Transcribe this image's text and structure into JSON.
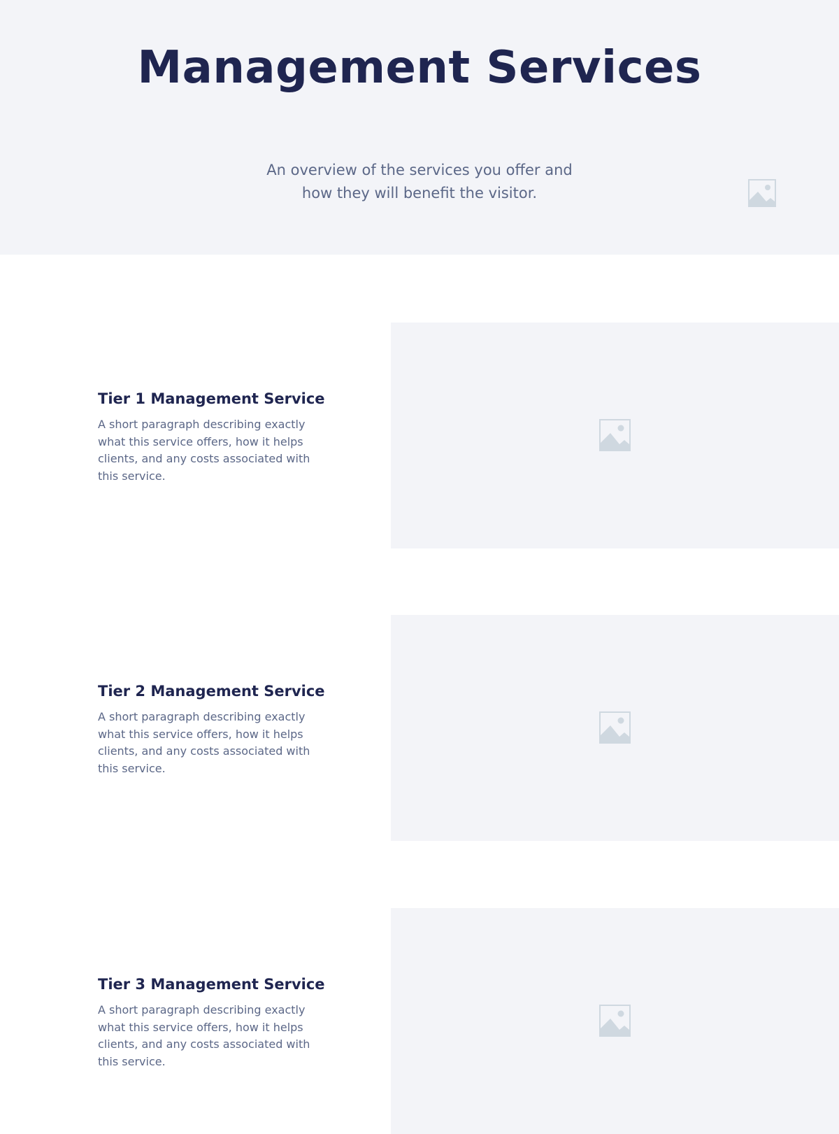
{
  "hero": {
    "title": "Management Services",
    "subtitle": "An overview of the services you offer and how they will benefit the visitor.",
    "icon": "image-placeholder-icon"
  },
  "services": [
    {
      "title": "Tier 1 Management Service",
      "description": "A short paragraph describing exactly what this service offers, how it helps clients, and any costs associated with this service.",
      "image_icon": "image-placeholder-icon"
    },
    {
      "title": "Tier 2 Management Service",
      "description": "A short paragraph describing exactly what this service offers, how it helps clients, and any costs associated with this service.",
      "image_icon": "image-placeholder-icon"
    },
    {
      "title": "Tier 3 Management Service",
      "description": "A short paragraph describing exactly what this service offers, how it helps clients, and any costs associated with this service.",
      "image_icon": "image-placeholder-icon"
    }
  ],
  "colors": {
    "heading": "#1f2550",
    "body_text": "#5b6787",
    "panel_background": "#f3f4f8",
    "icon": "#cfd8e0"
  }
}
